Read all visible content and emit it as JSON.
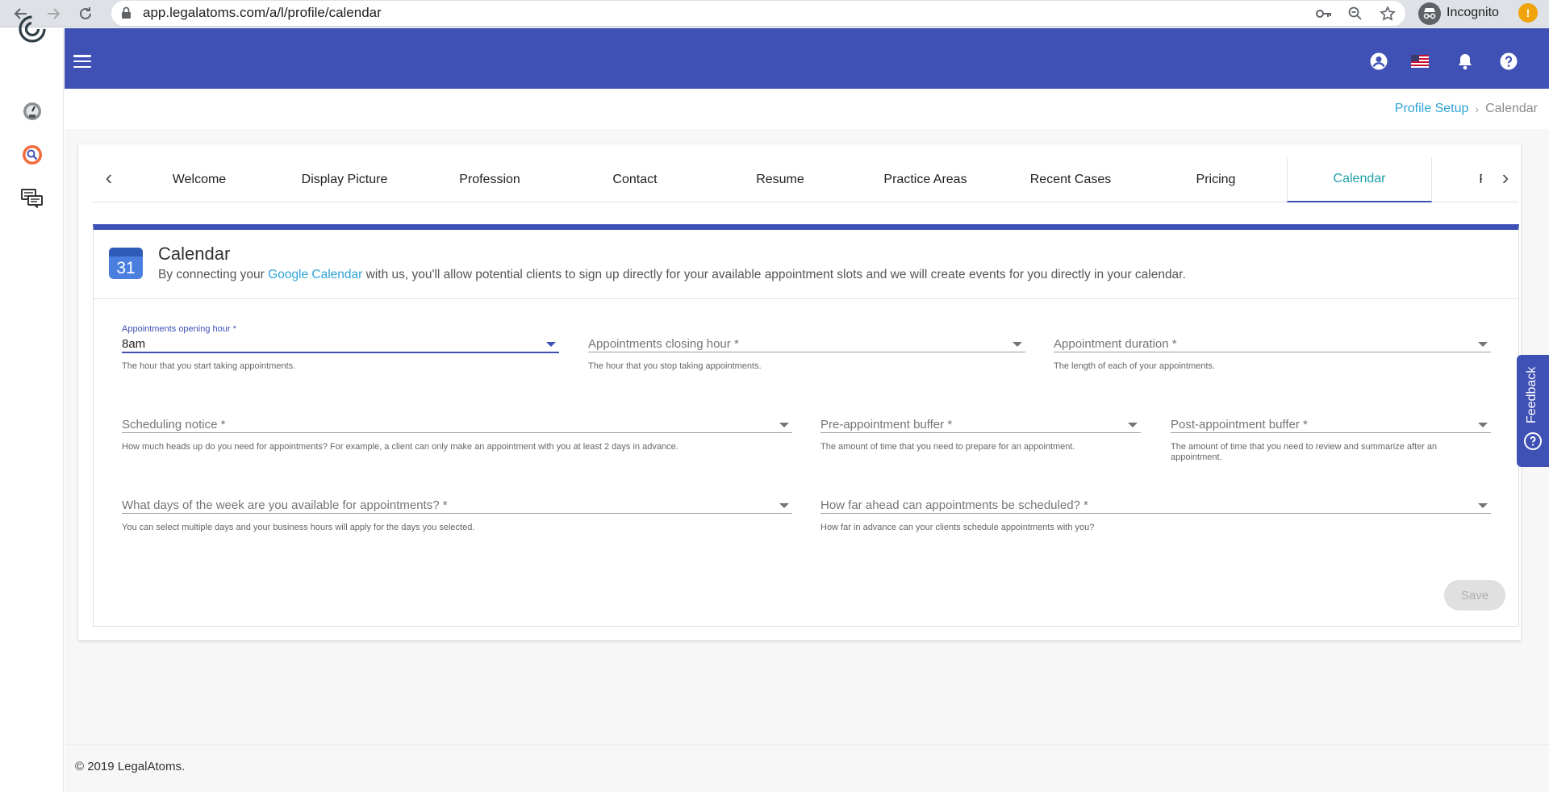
{
  "browser": {
    "url": "app.legalatoms.com/a/l/profile/calendar",
    "profile_label": "Incognito",
    "alert_symbol": "!"
  },
  "icons": {
    "back": "arrow-left-icon",
    "forward": "arrow-right-icon",
    "reload": "reload-icon",
    "lock": "lock-icon",
    "key": "key-icon",
    "zoom": "zoom-out-icon",
    "star": "star-icon",
    "incognito": "incognito-icon",
    "menu": "hamburger-icon",
    "account": "account-icon",
    "flag": "us-flag-icon",
    "bell": "bell-icon",
    "help": "help-icon"
  },
  "colors": {
    "primary": "#3f51b5",
    "link": "#2fa3d6",
    "active_tab_text": "#1e9fa8"
  },
  "breadcrumb": {
    "parent": "Profile Setup",
    "separator": "›",
    "current": "Calendar"
  },
  "tabs": {
    "prev_arrow": "‹",
    "next_arrow": "›",
    "items": [
      {
        "label": "Welcome"
      },
      {
        "label": "Display Picture"
      },
      {
        "label": "Profession"
      },
      {
        "label": "Contact"
      },
      {
        "label": "Resume"
      },
      {
        "label": "Practice Areas"
      },
      {
        "label": "Recent Cases"
      },
      {
        "label": "Pricing"
      },
      {
        "label": "Calendar"
      },
      {
        "label": "P"
      }
    ],
    "active_label": "Calendar"
  },
  "panel": {
    "icon_number": "31",
    "title": "Calendar",
    "desc_before": "By connecting your ",
    "desc_link": "Google Calendar",
    "desc_after": " with us, you'll allow potential clients to sign up directly for your available appointment slots and we will create events for you directly in your calendar."
  },
  "form": {
    "opening_hour": {
      "label": "Appointments opening hour *",
      "value": "8am",
      "hint": "The hour that you start taking appointments."
    },
    "closing_hour": {
      "placeholder": "Appointments closing hour *",
      "hint": "The hour that you stop taking appointments."
    },
    "duration": {
      "placeholder": "Appointment duration *",
      "hint": "The length of each of your appointments."
    },
    "scheduling_notice": {
      "placeholder": "Scheduling notice *",
      "hint": "How much heads up do you need for appointments? For example, a client can only make an appointment with you at least 2 days in advance."
    },
    "pre_buffer": {
      "placeholder": "Pre-appointment buffer *",
      "hint": "The amount of time that you need to prepare for an appointment."
    },
    "post_buffer": {
      "placeholder": "Post-appointment buffer *",
      "hint": "The amount of time that you need to review and summarize after an appointment."
    },
    "days_of_week": {
      "placeholder": "What days of the week are you available for appointments? *",
      "hint": "You can select multiple days and your business hours will apply for the days you selected."
    },
    "how_far_ahead": {
      "placeholder": "How far ahead can appointments be scheduled? *",
      "hint": "How far in advance can your clients schedule appointments with you?"
    },
    "save_label": "Save"
  },
  "feedback": {
    "label": "Feedback"
  },
  "footer": {
    "text": "© 2019 LegalAtoms."
  }
}
